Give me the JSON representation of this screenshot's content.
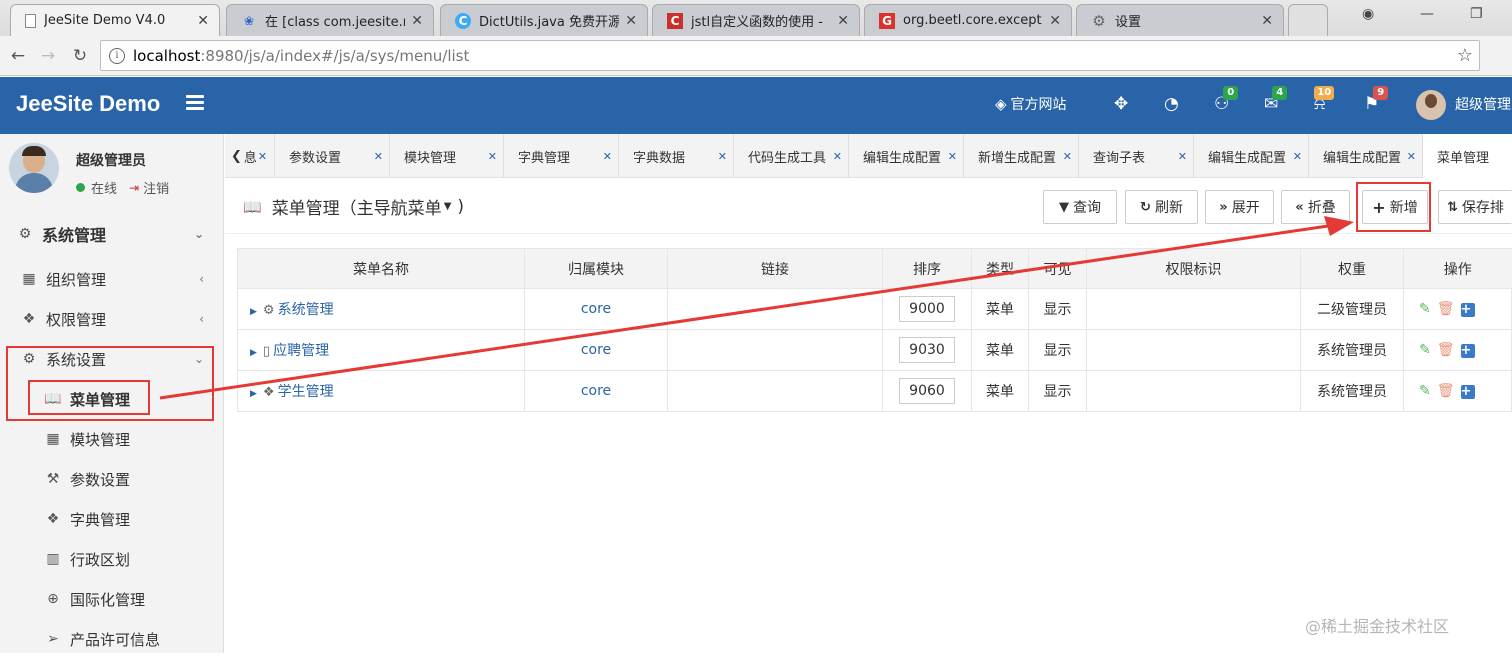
{
  "browser": {
    "tabs": [
      {
        "title": "JeeSite Demo V4.0",
        "icon": "page-icon"
      },
      {
        "title": "在 [class com.jeesite.m",
        "icon": "baidu-paw-icon"
      },
      {
        "title": "DictUtils.java 免费开源",
        "icon": "circle-c-icon"
      },
      {
        "title": "jstl自定义函数的使用 -",
        "icon": "csdn-c-icon"
      },
      {
        "title": "org.beetl.core.except",
        "icon": "g-logo-icon"
      },
      {
        "title": "设置",
        "icon": "gear-icon"
      }
    ],
    "url_host": "localhost",
    "url_path": ":8980/js/a/index#/js/a/sys/menu/list"
  },
  "header": {
    "brand": "JeeSite Demo",
    "official_site": "官方网站",
    "badges": {
      "users": "0",
      "mail": "4",
      "bell": "10",
      "flag": "9"
    },
    "badge_colors": {
      "users": "#2da44e",
      "mail": "#2da44e",
      "bell": "#f0ad4e",
      "flag": "#d9534f"
    },
    "user": "超级管理"
  },
  "sidebar": {
    "user_name": "超级管理员",
    "status": "在线",
    "logout": "注销",
    "items": [
      {
        "label": "系统管理",
        "icon": "gear-icon"
      },
      {
        "label": "组织管理",
        "icon": "grid-icon"
      },
      {
        "label": "权限管理",
        "icon": "cube-icon"
      },
      {
        "label": "系统设置",
        "icon": "gear-icon"
      },
      {
        "label": "菜单管理",
        "icon": "book-icon"
      },
      {
        "label": "模块管理",
        "icon": "grid-icon"
      },
      {
        "label": "参数设置",
        "icon": "wrench-icon"
      },
      {
        "label": "字典管理",
        "icon": "cube-icon"
      },
      {
        "label": "行政区划",
        "icon": "map-icon"
      },
      {
        "label": "国际化管理",
        "icon": "globe-icon"
      },
      {
        "label": "产品许可信息",
        "icon": "send-icon"
      }
    ]
  },
  "content_tabs": {
    "prev": "息",
    "tabs": [
      "参数设置",
      "模块管理",
      "字典管理",
      "字典数据",
      "代码生成工具",
      "编辑生成配置",
      "新增生成配置",
      "查询子表",
      "编辑生成配置",
      "编辑生成配置",
      "菜单管理"
    ]
  },
  "page": {
    "title": "菜单管理（主导航菜单",
    "buttons": {
      "query": "查询",
      "refresh": "刷新",
      "expand": "展开",
      "collapse": "折叠",
      "add": "新增",
      "save": "保存排"
    }
  },
  "table": {
    "columns": [
      "菜单名称",
      "归属模块",
      "链接",
      "排序",
      "类型",
      "可见",
      "权限标识",
      "权重",
      "操作"
    ],
    "rows": [
      {
        "name": "系统管理",
        "icon": "gear-icon",
        "module": "core",
        "link": "",
        "sort": "9000",
        "type": "菜单",
        "visible": "显示",
        "perm": "",
        "weight": "二级管理员"
      },
      {
        "name": "应聘管理",
        "icon": "book-icon",
        "module": "core",
        "link": "",
        "sort": "9030",
        "type": "菜单",
        "visible": "显示",
        "perm": "",
        "weight": "系统管理员"
      },
      {
        "name": "学生管理",
        "icon": "cube-icon",
        "module": "core",
        "link": "",
        "sort": "9060",
        "type": "菜单",
        "visible": "显示",
        "perm": "",
        "weight": "系统管理员"
      }
    ]
  },
  "watermark": "@稀土掘金技术社区",
  "colors": {
    "header": "#2a64a8",
    "link": "#2a64a8",
    "annotation": "#e53935"
  }
}
